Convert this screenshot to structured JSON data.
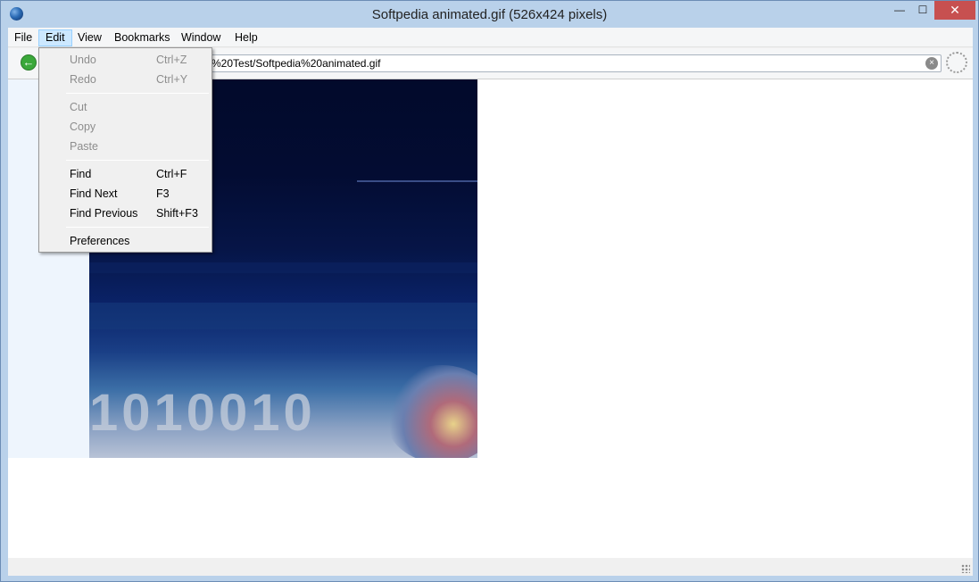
{
  "window": {
    "title": "Softpedia animated.gif (526x424 pixels)",
    "min_glyph": "—",
    "max_glyph": "☐",
    "close_glyph": "✕"
  },
  "menubar": {
    "items": [
      {
        "label": "File"
      },
      {
        "label": "Edit"
      },
      {
        "label": "View"
      },
      {
        "label": "Bookmarks"
      },
      {
        "label": "Window"
      },
      {
        "label": "Help"
      }
    ],
    "active": "Edit"
  },
  "toolbar": {
    "back_glyph": "←",
    "address_value": "%20Test/Softpedia%20animated.gif",
    "clear_glyph": "×"
  },
  "edit_menu": {
    "items": [
      {
        "label": "Undo",
        "shortcut": "Ctrl+Z",
        "enabled": false
      },
      {
        "label": "Redo",
        "shortcut": "Ctrl+Y",
        "enabled": false
      },
      {
        "label": "Cut",
        "shortcut": "",
        "enabled": false
      },
      {
        "label": "Copy",
        "shortcut": "",
        "enabled": false
      },
      {
        "label": "Paste",
        "shortcut": "",
        "enabled": false
      },
      {
        "label": "Find",
        "shortcut": "Ctrl+F",
        "enabled": true
      },
      {
        "label": "Find Next",
        "shortcut": "F3",
        "enabled": true
      },
      {
        "label": "Find Previous",
        "shortcut": "Shift+F3",
        "enabled": true
      },
      {
        "label": "Preferences",
        "shortcut": "",
        "enabled": true
      }
    ]
  },
  "image": {
    "overlay_digits": "1010010"
  },
  "colors": {
    "titlebar": "#b9d1ea",
    "close_button": "#c75050",
    "menu_highlight": "#cce8ff",
    "disabled_text": "#8d8d8d"
  }
}
